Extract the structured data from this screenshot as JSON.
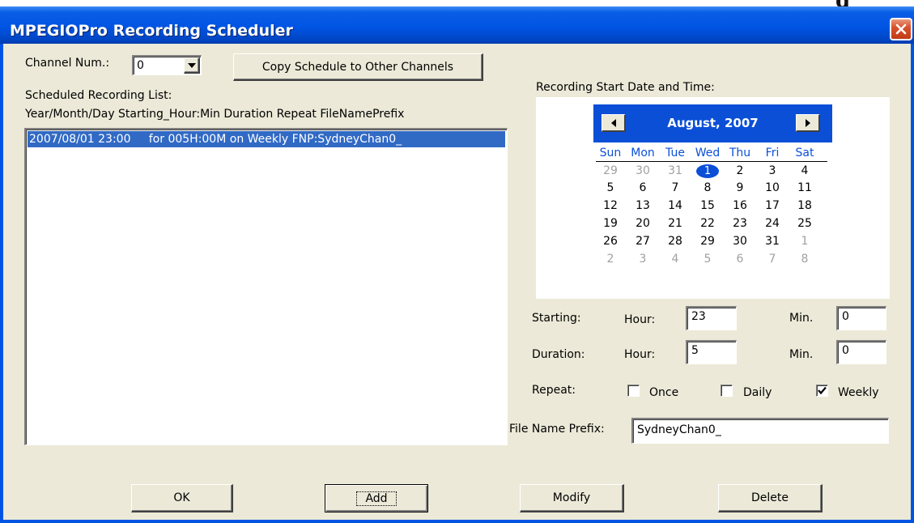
{
  "window": {
    "title": "MPEGIOPro Recording Scheduler",
    "clipped_text": "g"
  },
  "channel": {
    "label": "Channel Num.:",
    "value": "0",
    "copy_button": "Copy Schedule to Other Channels"
  },
  "schedule_list": {
    "label": "Scheduled Recording List:",
    "header": "Year/Month/Day  Starting_Hour:Min  Duration Repeat  FileNamePrefix",
    "items": [
      {
        "text": "2007/08/01 23:00     for 005H:00M on Weekly FNP:SydneyChan0_",
        "selected": true
      }
    ]
  },
  "calendar": {
    "label": "Recording Start Date and Time:",
    "month_label": "August, 2007",
    "weekdays": [
      "Sun",
      "Mon",
      "Tue",
      "Wed",
      "Thu",
      "Fri",
      "Sat"
    ],
    "weeks": [
      [
        {
          "d": "29",
          "dim": true
        },
        {
          "d": "30",
          "dim": true
        },
        {
          "d": "31",
          "dim": true
        },
        {
          "d": "1",
          "sel": true
        },
        {
          "d": "2"
        },
        {
          "d": "3"
        },
        {
          "d": "4"
        }
      ],
      [
        {
          "d": "5"
        },
        {
          "d": "6"
        },
        {
          "d": "7"
        },
        {
          "d": "8"
        },
        {
          "d": "9"
        },
        {
          "d": "10"
        },
        {
          "d": "11"
        }
      ],
      [
        {
          "d": "12"
        },
        {
          "d": "13"
        },
        {
          "d": "14"
        },
        {
          "d": "15"
        },
        {
          "d": "16"
        },
        {
          "d": "17"
        },
        {
          "d": "18"
        }
      ],
      [
        {
          "d": "19"
        },
        {
          "d": "20"
        },
        {
          "d": "21"
        },
        {
          "d": "22"
        },
        {
          "d": "23"
        },
        {
          "d": "24"
        },
        {
          "d": "25"
        }
      ],
      [
        {
          "d": "26"
        },
        {
          "d": "27"
        },
        {
          "d": "28"
        },
        {
          "d": "29"
        },
        {
          "d": "30"
        },
        {
          "d": "31"
        },
        {
          "d": "1",
          "dim": true
        }
      ],
      [
        {
          "d": "2",
          "dim": true
        },
        {
          "d": "3",
          "dim": true
        },
        {
          "d": "4",
          "dim": true
        },
        {
          "d": "5",
          "dim": true
        },
        {
          "d": "6",
          "dim": true
        },
        {
          "d": "7",
          "dim": true
        },
        {
          "d": "8",
          "dim": true
        }
      ]
    ]
  },
  "starting": {
    "label": "Starting:",
    "hour_label": "Hour:",
    "hour_value": "23",
    "min_label": "Min.",
    "min_value": "0"
  },
  "duration": {
    "label": "Duration:",
    "hour_label": "Hour:",
    "hour_value": "5",
    "min_label": "Min.",
    "min_value": "0"
  },
  "repeat": {
    "label": "Repeat:",
    "once_label": "Once",
    "once_checked": false,
    "daily_label": "Daily",
    "daily_checked": false,
    "weekly_label": "Weekly",
    "weekly_checked": true
  },
  "file_prefix": {
    "label": "File Name Prefix:",
    "value": "SydneyChan0_"
  },
  "buttons": {
    "ok": "OK",
    "add": "Add",
    "modify": "Modify",
    "delete": "Delete"
  },
  "colors": {
    "titlebar": "#0054e3",
    "selection": "#316ac5",
    "calendar_header": "#0b4fd7",
    "dialog_bg": "#ece9d8"
  }
}
